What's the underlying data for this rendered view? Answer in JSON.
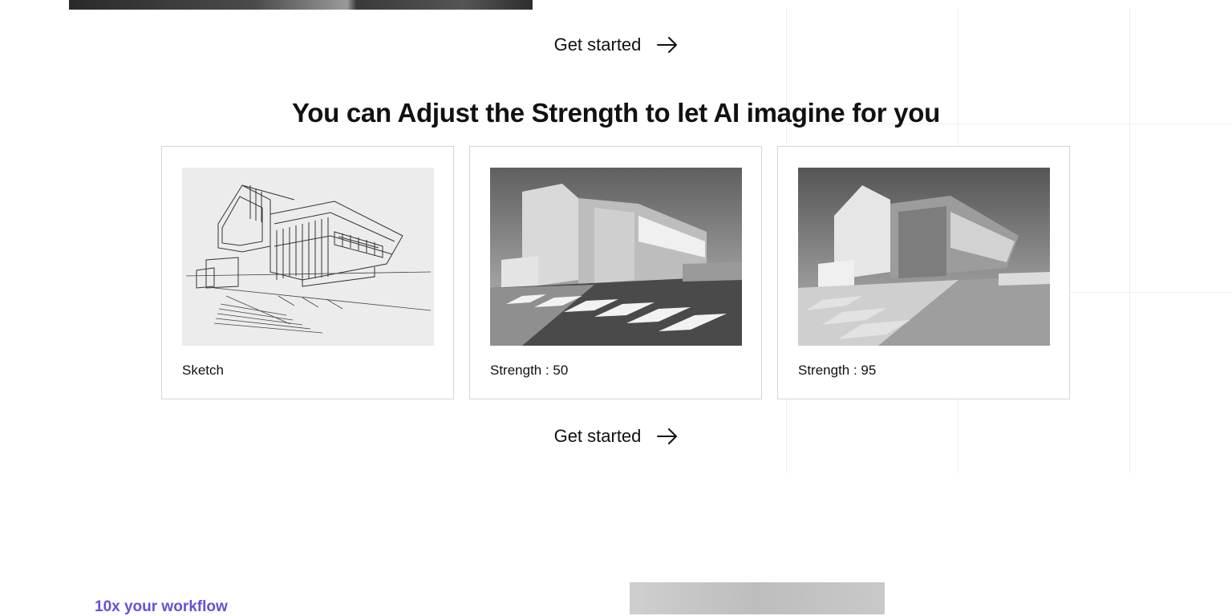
{
  "cta": {
    "label": "Get started"
  },
  "section": {
    "title": "You can Adjust the Strength to let AI imagine for you"
  },
  "cards": [
    {
      "caption": "Sketch"
    },
    {
      "caption": "Strength : 50"
    },
    {
      "caption": "Strength : 95"
    }
  ],
  "next_section": {
    "label": "10x your workflow"
  },
  "colors": {
    "accent": "#6a4fd6",
    "border": "#d6d6d6",
    "text": "#111111"
  },
  "icons": {
    "cta": "arrow-right-icon"
  }
}
